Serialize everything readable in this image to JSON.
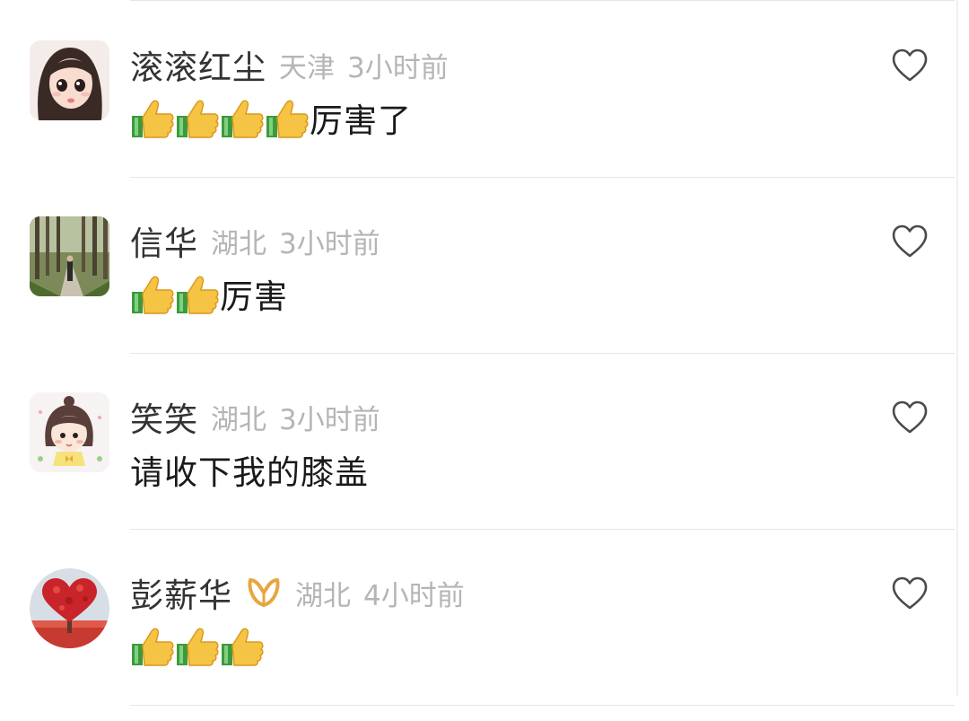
{
  "comments": [
    {
      "username": "滚滚红尘",
      "location": "天津",
      "time": "3小时前",
      "thumbs": 4,
      "text": "厉害了",
      "avatar_icon": "anime-girl-avatar",
      "has_badge": false
    },
    {
      "username": "信华",
      "location": "湖北",
      "time": "3小时前",
      "thumbs": 2,
      "text": "厉害",
      "avatar_icon": "forest-path-photo-avatar",
      "has_badge": false
    },
    {
      "username": "笑笑",
      "location": "湖北",
      "time": "3小时前",
      "thumbs": 0,
      "text": "请收下我的膝盖",
      "avatar_icon": "cartoon-girl-avatar",
      "has_badge": false
    },
    {
      "username": "彭薪华",
      "location": "湖北",
      "time": "4小时前",
      "thumbs": 3,
      "text": "",
      "avatar_icon": "heart-tree-avatar",
      "has_badge": true,
      "badge_icon": "gold-infinity-badge-icon"
    }
  ],
  "icons": {
    "like": "heart-outline-icon",
    "emoji": "thumbs-up-emoji-icon"
  },
  "colors": {
    "username": "#333333",
    "meta": "#b5b5b5",
    "text": "#1a1a1a",
    "divider": "#e6e6e6",
    "badge": "#e8a640"
  }
}
